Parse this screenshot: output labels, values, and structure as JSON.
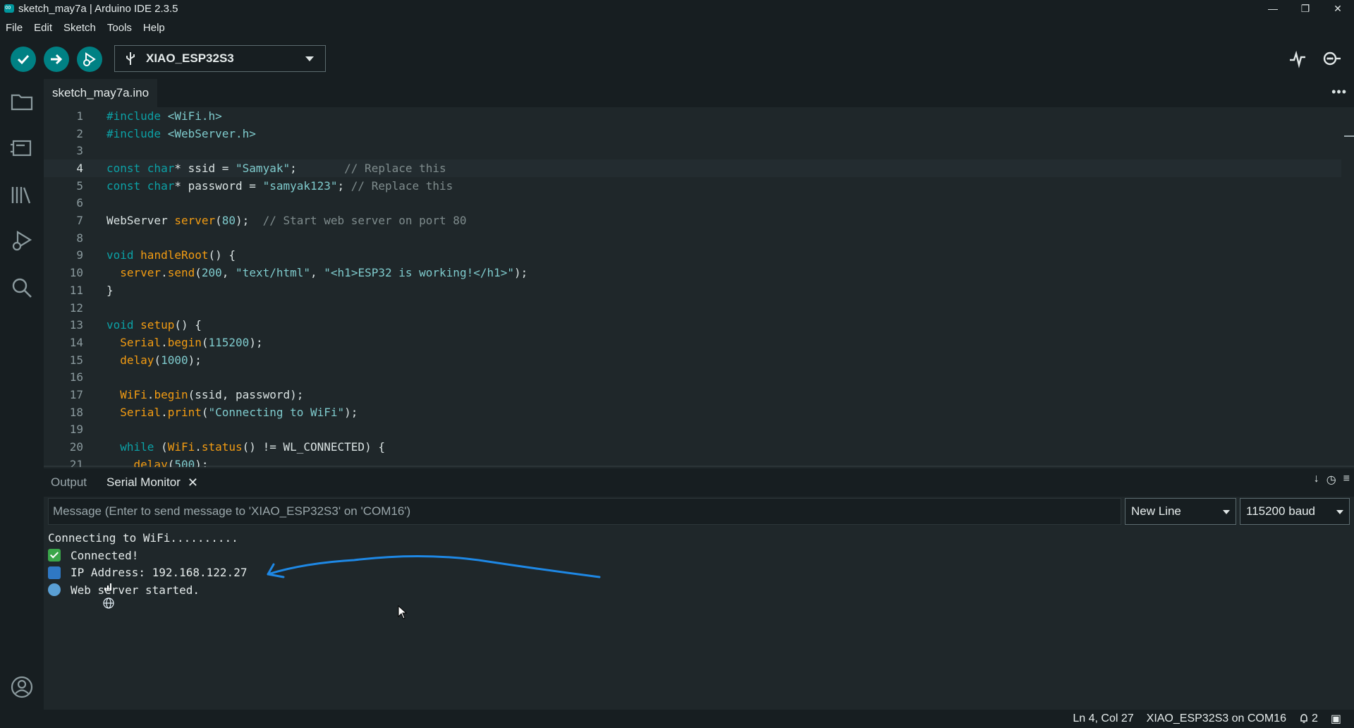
{
  "window": {
    "title": "sketch_may7a | Arduino IDE 2.3.5",
    "controls": [
      "minimize",
      "restore",
      "close"
    ]
  },
  "menu": [
    "File",
    "Edit",
    "Sketch",
    "Tools",
    "Help"
  ],
  "toolbar": {
    "verify_icon": "check-icon",
    "upload_icon": "arrow-right-icon",
    "debug_icon": "debug-icon",
    "board": "XIAO_ESP32S3",
    "serial_plotter_icon": "plotter-icon",
    "serial_monitor_icon": "serial-monitor-icon"
  },
  "sidebar": [
    "folder-icon",
    "boards-manager-icon",
    "library-icon",
    "debug-icon",
    "search-icon",
    "account-icon"
  ],
  "editor": {
    "tab": "sketch_may7a.ino",
    "current_line": 4,
    "lines": [
      {
        "n": "1",
        "parts": [
          [
            "kw",
            "#include"
          ],
          [
            "",
            " "
          ],
          [
            "str",
            "<WiFi.h>"
          ]
        ]
      },
      {
        "n": "2",
        "parts": [
          [
            "kw",
            "#include"
          ],
          [
            "",
            " "
          ],
          [
            "str",
            "<WebServer.h>"
          ]
        ]
      },
      {
        "n": "3",
        "parts": []
      },
      {
        "n": "4",
        "parts": [
          [
            "kw",
            "const char"
          ],
          [
            "",
            "* ssid = "
          ],
          [
            "str",
            "\"Samyak\""
          ],
          [
            "",
            ";       "
          ],
          [
            "cm",
            "// Replace this"
          ]
        ]
      },
      {
        "n": "5",
        "parts": [
          [
            "kw",
            "const char"
          ],
          [
            "",
            "* password = "
          ],
          [
            "str",
            "\"samyak123\""
          ],
          [
            "",
            "; "
          ],
          [
            "cm",
            "// Replace this"
          ]
        ]
      },
      {
        "n": "6",
        "parts": []
      },
      {
        "n": "7",
        "parts": [
          [
            "",
            "WebServer "
          ],
          [
            "fn",
            "server"
          ],
          [
            "",
            "("
          ],
          [
            "num",
            "80"
          ],
          [
            "",
            ");  "
          ],
          [
            "cm",
            "// Start web server on port 80"
          ]
        ]
      },
      {
        "n": "8",
        "parts": []
      },
      {
        "n": "9",
        "parts": [
          [
            "kw",
            "void"
          ],
          [
            "",
            " "
          ],
          [
            "fn",
            "handleRoot"
          ],
          [
            "",
            "() {"
          ]
        ]
      },
      {
        "n": "10",
        "parts": [
          [
            "",
            "  "
          ],
          [
            "fn",
            "server"
          ],
          [
            "",
            "."
          ],
          [
            "fn",
            "send"
          ],
          [
            "",
            "("
          ],
          [
            "num",
            "200"
          ],
          [
            "",
            ", "
          ],
          [
            "str",
            "\"text/html\""
          ],
          [
            "",
            ", "
          ],
          [
            "str",
            "\"<h1>ESP32 is working!</h1>\""
          ],
          [
            "",
            ");"
          ]
        ]
      },
      {
        "n": "11",
        "parts": [
          [
            "",
            "}"
          ]
        ]
      },
      {
        "n": "12",
        "parts": []
      },
      {
        "n": "13",
        "parts": [
          [
            "kw",
            "void"
          ],
          [
            "",
            " "
          ],
          [
            "fn",
            "setup"
          ],
          [
            "",
            "() {"
          ]
        ]
      },
      {
        "n": "14",
        "parts": [
          [
            "",
            "  "
          ],
          [
            "fn",
            "Serial"
          ],
          [
            "",
            "."
          ],
          [
            "fn",
            "begin"
          ],
          [
            "",
            "("
          ],
          [
            "num",
            "115200"
          ],
          [
            "",
            ");"
          ]
        ]
      },
      {
        "n": "15",
        "parts": [
          [
            "",
            "  "
          ],
          [
            "fn",
            "delay"
          ],
          [
            "",
            "("
          ],
          [
            "num",
            "1000"
          ],
          [
            "",
            ");"
          ]
        ]
      },
      {
        "n": "16",
        "parts": []
      },
      {
        "n": "17",
        "parts": [
          [
            "",
            "  "
          ],
          [
            "fn",
            "WiFi"
          ],
          [
            "",
            "."
          ],
          [
            "fn",
            "begin"
          ],
          [
            "",
            "(ssid, password);"
          ]
        ]
      },
      {
        "n": "18",
        "parts": [
          [
            "",
            "  "
          ],
          [
            "fn",
            "Serial"
          ],
          [
            "",
            "."
          ],
          [
            "fn",
            "print"
          ],
          [
            "",
            "("
          ],
          [
            "str",
            "\"Connecting to WiFi\""
          ],
          [
            "",
            ");"
          ]
        ]
      },
      {
        "n": "19",
        "parts": []
      },
      {
        "n": "20",
        "parts": [
          [
            "",
            "  "
          ],
          [
            "kw",
            "while"
          ],
          [
            "",
            " ("
          ],
          [
            "fn",
            "WiFi"
          ],
          [
            "",
            "."
          ],
          [
            "fn",
            "status"
          ],
          [
            "",
            "() != WL_CONNECTED) {"
          ]
        ]
      },
      {
        "n": "21",
        "parts": [
          [
            "",
            "    "
          ],
          [
            "fn",
            "delay"
          ],
          [
            "",
            "("
          ],
          [
            "num",
            "500"
          ],
          [
            "",
            ");"
          ]
        ]
      }
    ]
  },
  "panel": {
    "tabs": [
      {
        "label": "Output"
      },
      {
        "label": "Serial Monitor"
      }
    ],
    "active_tab": "Serial Monitor",
    "message_placeholder": "Message (Enter to send message to 'XIAO_ESP32S3' on 'COM16')",
    "line_ending": "New Line",
    "baud": "115200 baud",
    "output": [
      {
        "icon": "",
        "text": "Connecting to WiFi.........."
      },
      {
        "icon": "check-emoji-icon",
        "text": "Connected!"
      },
      {
        "icon": "signal-bars-icon",
        "text": "IP Address: 192.168.122.27"
      },
      {
        "icon": "globe-icon",
        "text": "Web server started."
      }
    ]
  },
  "status": {
    "position": "Ln 4, Col 27",
    "board_port": "XIAO_ESP32S3 on COM16",
    "notifications": "2"
  },
  "colors": {
    "teal_accent": "#008184",
    "annotation_arrow": "#1e88e5"
  }
}
